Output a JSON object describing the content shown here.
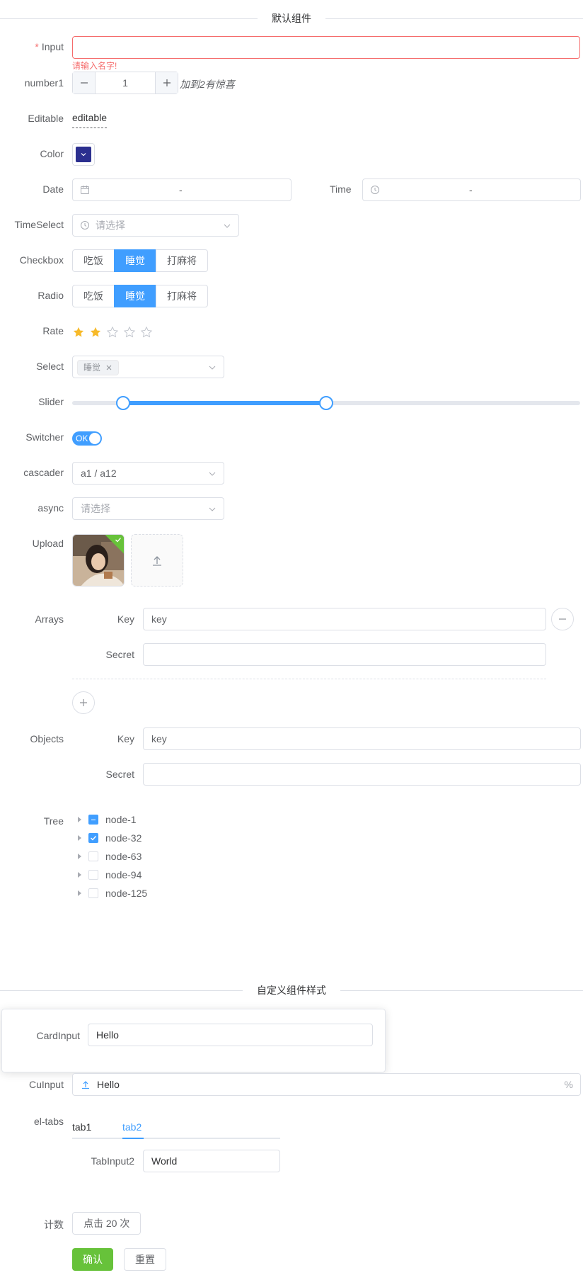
{
  "sections": {
    "default_title": "默认组件",
    "custom_title": "自定义组件样式"
  },
  "input": {
    "label": "Input",
    "required_mark": "*",
    "value": "",
    "error": "请输入名字!"
  },
  "number1": {
    "label": "number1",
    "value": "1",
    "hint": "加到2有惊喜"
  },
  "editable": {
    "label": "Editable",
    "value": "editable"
  },
  "color": {
    "label": "Color",
    "value": "#2b2f8f"
  },
  "date": {
    "label": "Date",
    "separator": "-"
  },
  "time": {
    "label": "Time",
    "separator": "-"
  },
  "time_select": {
    "label": "TimeSelect",
    "placeholder": "请选择"
  },
  "checkbox": {
    "label": "Checkbox",
    "options": [
      "吃饭",
      "睡觉",
      "打麻将"
    ],
    "selected": "睡觉"
  },
  "radio": {
    "label": "Radio",
    "options": [
      "吃饭",
      "睡觉",
      "打麻将"
    ],
    "selected": "睡觉"
  },
  "rate": {
    "label": "Rate",
    "value": 2,
    "max": 5,
    "color": "#f7ba2a"
  },
  "select": {
    "label": "Select",
    "tags": [
      "睡觉"
    ]
  },
  "slider": {
    "label": "Slider",
    "range": [
      10,
      50
    ],
    "min": 0,
    "max": 100
  },
  "switcher": {
    "label": "Switcher",
    "on_text": "OK",
    "checked": true
  },
  "cascader": {
    "label": "cascader",
    "value": "a1 / a12"
  },
  "async": {
    "label": "async",
    "placeholder": "请选择"
  },
  "upload": {
    "label": "Upload"
  },
  "arrays": {
    "label": "Arrays",
    "key_label": "Key",
    "key_value": "key",
    "secret_label": "Secret",
    "secret_value": ""
  },
  "objects": {
    "label": "Objects",
    "key_label": "Key",
    "key_value": "key",
    "secret_label": "Secret",
    "secret_value": ""
  },
  "tree": {
    "label": "Tree",
    "nodes": [
      {
        "label": "node-1",
        "state": "indeterminate"
      },
      {
        "label": "node-32",
        "state": "checked"
      },
      {
        "label": "node-63",
        "state": "unchecked"
      },
      {
        "label": "node-94",
        "state": "unchecked"
      },
      {
        "label": "node-125",
        "state": "unchecked"
      }
    ]
  },
  "card_input": {
    "label": "CardInput",
    "value": "Hello"
  },
  "cu_input": {
    "label": "CuInput",
    "value": "Hello",
    "suffix": "%"
  },
  "el_tabs": {
    "label": "el-tabs",
    "tabs": [
      "tab1",
      "tab2"
    ],
    "active": "tab2",
    "inner_label": "TabInput2",
    "inner_value": "World"
  },
  "counter": {
    "label": "计数",
    "button": "点击 20 次"
  },
  "actions": {
    "confirm": "确认",
    "reset": "重置"
  },
  "colors": {
    "primary": "#409eff",
    "success": "#67c23a",
    "danger": "#f56c6c"
  }
}
